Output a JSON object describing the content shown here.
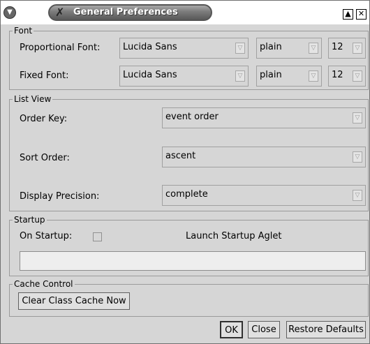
{
  "window": {
    "title": "General Preferences",
    "menu_icon": "chevron-down-icon",
    "shade_label": "▲",
    "close_label": "✕"
  },
  "font": {
    "legend": "Font",
    "proportional_label": "Proportional Font:",
    "proportional_family": "Lucida Sans",
    "proportional_style": "plain",
    "proportional_size": "12",
    "fixed_label": "Fixed Font:",
    "fixed_family": "Lucida Sans",
    "fixed_style": "plain",
    "fixed_size": "12"
  },
  "list_view": {
    "legend": "List View",
    "order_key_label": "Order Key:",
    "order_key_value": "event order",
    "sort_order_label": "Sort Order:",
    "sort_order_value": "ascent",
    "precision_label": "Display Precision:",
    "precision_value": "complete"
  },
  "startup": {
    "legend": "Startup",
    "on_startup_label": "On Startup:",
    "launch_label": "Launch Startup Aglet",
    "path_value": ""
  },
  "cache": {
    "legend": "Cache Control",
    "clear_label": "Clear Class Cache Now"
  },
  "buttons": {
    "ok": "OK",
    "close": "Close",
    "restore": "Restore Defaults"
  },
  "colors": {
    "window_bg": "#d6d6d6",
    "title_pill": "#6a6a6a"
  }
}
